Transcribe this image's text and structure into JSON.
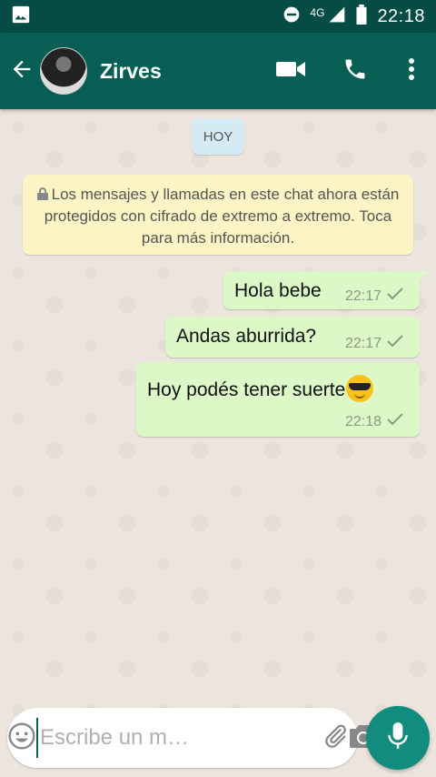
{
  "status_bar": {
    "network": "4G",
    "time": "22:18",
    "icons": [
      "image-icon",
      "do-not-disturb-icon",
      "signal-icon",
      "battery-icon"
    ]
  },
  "app_bar": {
    "contact_name": "Zirves",
    "icons": [
      "back-arrow-icon",
      "video-call-icon",
      "phone-icon",
      "more-vert-icon"
    ]
  },
  "chat": {
    "date_chip": "HOY",
    "encryption_notice": "Los mensajes y llamadas en este chat ahora están protegidos con cifrado de extremo a extremo. Toca para más información.",
    "messages": [
      {
        "text": "Hola bebe",
        "time": "22:17",
        "status": "sent"
      },
      {
        "text": "Andas aburrida?",
        "time": "22:17",
        "status": "sent"
      },
      {
        "text": "Hoy podés tener suerte",
        "emoji": "smiling-face-with-sunglasses",
        "time": "22:18",
        "status": "sent"
      }
    ]
  },
  "composer": {
    "placeholder": "Escribe un m…",
    "icons": [
      "emoji-icon",
      "attach-icon",
      "camera-icon",
      "mic-icon"
    ]
  },
  "colors": {
    "status_bar": "#054d44",
    "app_bar": "#075e54",
    "chat_background": "#ece5dd",
    "outgoing_bubble": "#dcf8c6",
    "notice_bubble": "#fdf4c5",
    "date_chip": "#d4eaf4",
    "fab": "#128c7e"
  }
}
